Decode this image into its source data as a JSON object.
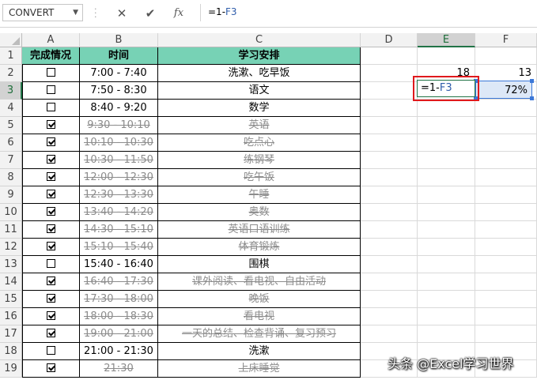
{
  "formula_bar": {
    "name_box": "CONVERT",
    "cancel_glyph": "✕",
    "enter_glyph": "✔",
    "fx_label": "fx",
    "formula_prefix": "=1-",
    "formula_ref": "F3"
  },
  "columns": [
    "A",
    "B",
    "C",
    "D",
    "E",
    "F"
  ],
  "rows": [
    "1",
    "2",
    "3",
    "4",
    "5",
    "6",
    "7",
    "8",
    "9",
    "10",
    "11",
    "12",
    "13",
    "14",
    "15",
    "16",
    "17",
    "18",
    "19"
  ],
  "table": {
    "headers": [
      "完成情况",
      "时间",
      "学习安排"
    ],
    "header_color": "#77d2b5",
    "rows": [
      {
        "done": false,
        "time": "7:00 - 7:40",
        "task": "洗漱、吃早饭"
      },
      {
        "done": false,
        "time": "7:50 - 8:30",
        "task": "语文"
      },
      {
        "done": false,
        "time": "8:40 - 9:20",
        "task": "数学"
      },
      {
        "done": true,
        "time": "9:30 - 10:10",
        "task": "英语"
      },
      {
        "done": true,
        "time": "10:10 - 10:30",
        "task": "吃点心"
      },
      {
        "done": true,
        "time": "10:30 - 11:50",
        "task": "练钢琴"
      },
      {
        "done": true,
        "time": "12:00 - 12:30",
        "task": "吃午饭"
      },
      {
        "done": true,
        "time": "12:30 - 13:30",
        "task": "午睡"
      },
      {
        "done": true,
        "time": "13:40 - 14:20",
        "task": "奥数"
      },
      {
        "done": true,
        "time": "14:30 - 15:10",
        "task": "英语口语训练"
      },
      {
        "done": true,
        "time": "15:10 - 15:40",
        "task": "体育锻炼"
      },
      {
        "done": false,
        "time": "15:40 - 16:40",
        "task": "围棋"
      },
      {
        "done": true,
        "time": "16:40 - 17:30",
        "task": "课外阅读、看电视、自由活动"
      },
      {
        "done": true,
        "time": "17:30 - 18:00",
        "task": "晚饭"
      },
      {
        "done": true,
        "time": "18:00 - 18:30",
        "task": "看电视"
      },
      {
        "done": true,
        "time": "19:00 - 21:00",
        "task": "一天的总结、检查背诵、复习预习"
      },
      {
        "done": false,
        "time": "21:00 - 21:30",
        "task": "洗漱"
      },
      {
        "done": true,
        "time": "21:30",
        "task": "上床睡觉"
      }
    ]
  },
  "side_values": {
    "e2": "18",
    "f2": "13",
    "e3_prefix": "=1-",
    "e3_ref": "F3",
    "f3": "72%"
  },
  "watermark": "头条 @Excel学习世界",
  "colors": {
    "selection_green": "#217346",
    "highlight_red": "#e0191c",
    "reference_blue": "#3c78d8",
    "done_gray": "#8c8c8c"
  }
}
